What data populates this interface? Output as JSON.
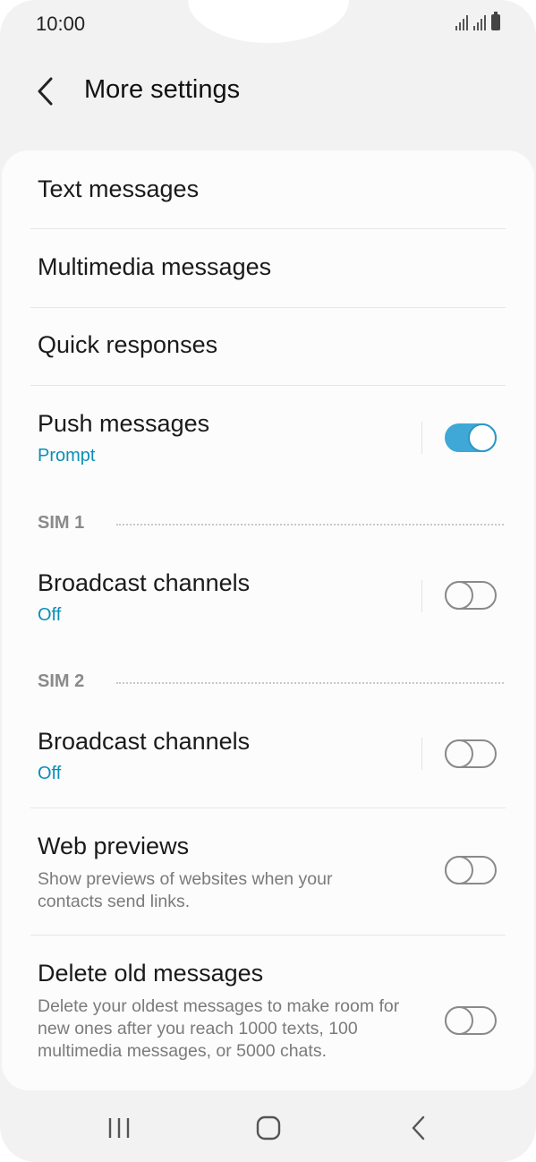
{
  "status_bar": {
    "time": "10:00"
  },
  "header": {
    "title": "More settings"
  },
  "items": {
    "text_messages": {
      "label": "Text messages"
    },
    "multimedia_messages": {
      "label": "Multimedia messages"
    },
    "quick_responses": {
      "label": "Quick responses"
    },
    "push_messages": {
      "label": "Push messages",
      "sub": "Prompt",
      "enabled": true
    },
    "broadcast_sim1": {
      "label": "Broadcast channels",
      "sub": "Off",
      "enabled": false
    },
    "broadcast_sim2": {
      "label": "Broadcast channels",
      "sub": "Off",
      "enabled": false
    },
    "web_previews": {
      "label": "Web previews",
      "desc": "Show previews of websites when your contacts send links.",
      "enabled": false
    },
    "delete_old": {
      "label": "Delete old messages",
      "desc": "Delete your oldest messages to make room for new ones after you reach 1000 texts, 100 multimedia messages, or 5000 chats.",
      "enabled": false
    }
  },
  "sections": {
    "sim1": "SIM 1",
    "sim2": "SIM 2"
  },
  "colors": {
    "accent": "#3fa8d6",
    "sub_text": "#0a8fb8",
    "background": "#f2f2f2",
    "card": "#fcfcfc"
  },
  "icons": {
    "back": "chevron-left-icon",
    "recents": "recents-icon",
    "home": "home-icon",
    "nav_back": "nav-back-icon"
  }
}
